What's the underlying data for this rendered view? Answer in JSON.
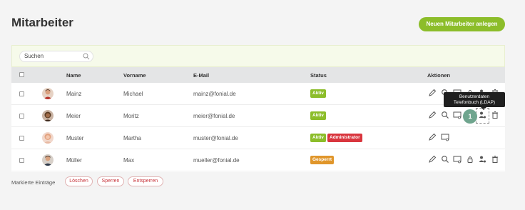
{
  "page": {
    "title": "Mitarbeiter"
  },
  "toolbar": {
    "new_employee_label": "Neuen Mitarbeiter anlegen"
  },
  "search": {
    "placeholder": "Suchen"
  },
  "table": {
    "headers": {
      "name": "Name",
      "vorname": "Vorname",
      "email": "E-Mail",
      "status": "Status",
      "aktionen": "Aktionen"
    },
    "rows": [
      {
        "name": "Mainz",
        "vorname": "Michael",
        "email": "mainz@fonial.de",
        "badges": [
          "Aktiv"
        ]
      },
      {
        "name": "Meier",
        "vorname": "Moritz",
        "email": "meier@fonial.de",
        "badges": [
          "Aktiv"
        ]
      },
      {
        "name": "Muster",
        "vorname": "Martha",
        "email": "muster@fonial.de",
        "badges": [
          "Aktiv",
          "Administrator"
        ]
      },
      {
        "name": "Müller",
        "vorname": "Max",
        "email": "mueller@fonial.de",
        "badges": [
          "Gesperrt"
        ]
      }
    ]
  },
  "footer": {
    "label": "Markierte Einträge",
    "delete_label": "Löschen",
    "lock_label": "Sperren",
    "unlock_label": "Entsperren"
  },
  "tooltip": {
    "line1": "Benutzerdaten",
    "line2": "Telefonbuch (LDAP)"
  },
  "step_marker": "1",
  "colors": {
    "accent": "#8cbd2a",
    "active": "#8cbd2a",
    "admin": "#d9363e",
    "locked": "#e0962b"
  },
  "icons": [
    "pencil-icon",
    "search-icon",
    "phone-list-icon",
    "lock-icon",
    "user-settings-icon",
    "trash-icon"
  ]
}
